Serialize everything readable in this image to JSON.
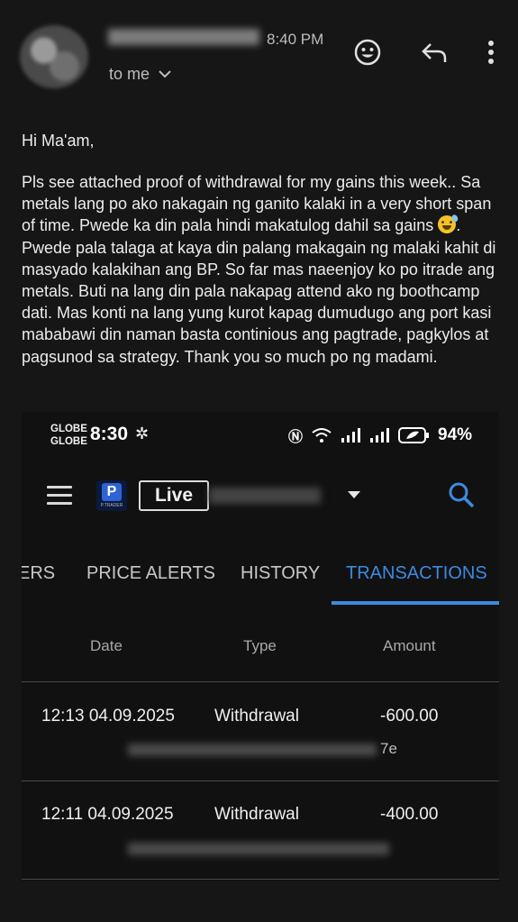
{
  "email": {
    "time": "8:40 PM",
    "recipient": "to me",
    "greeting": "Hi Ma'am,",
    "body_part1": "Pls see attached proof of withdrawal for my gains this week.. Sa metals lang po ako nakagain ng ganito kalaki in a very short span of time. Pwede ka din pala hindi makatulog dahil sa gains ",
    "body_part2": ". Pwede pala talaga at kaya din palang makagain ng malaki kahit di masyado kalakihan ang BP. So far mas naeenjoy ko po itrade ang metals. Buti na lang din pala nakapag attend ako ng boothcamp dati. Mas konti na lang yung kurot kapag dumudugo ang port kasi mababawi din naman basta continious ang pagtrade, pagkylos at pagsunod sa strategy. Thank you so much po ng madami.",
    "icons": [
      "emoji-icon",
      "reply-icon",
      "more-vert-icon"
    ]
  },
  "screenshot": {
    "status_bar": {
      "carrier_line1": "GLOBE",
      "carrier_line2": "GLOBE",
      "time": "8:30",
      "battery": "94%"
    },
    "app_bar": {
      "logo_letter": "P",
      "logo_sub": "P.TRADER",
      "account_mode": "Live"
    },
    "tabs": [
      {
        "label": "ERS",
        "active": false
      },
      {
        "label": "PRICE ALERTS",
        "active": false
      },
      {
        "label": "HISTORY",
        "active": false
      },
      {
        "label": "TRANSACTIONS",
        "active": true
      }
    ],
    "table": {
      "columns": [
        "Date",
        "Type",
        "Amount"
      ],
      "rows": [
        {
          "date": "12:13 04.09.2025",
          "type": "Withdrawal",
          "amount": "-600.00",
          "ref_tail": "7e"
        },
        {
          "date": "12:11 04.09.2025",
          "type": "Withdrawal",
          "amount": "-400.00",
          "ref_tail": ""
        }
      ]
    },
    "colors": {
      "accent": "#3d8ae0",
      "background": "#111111"
    }
  }
}
